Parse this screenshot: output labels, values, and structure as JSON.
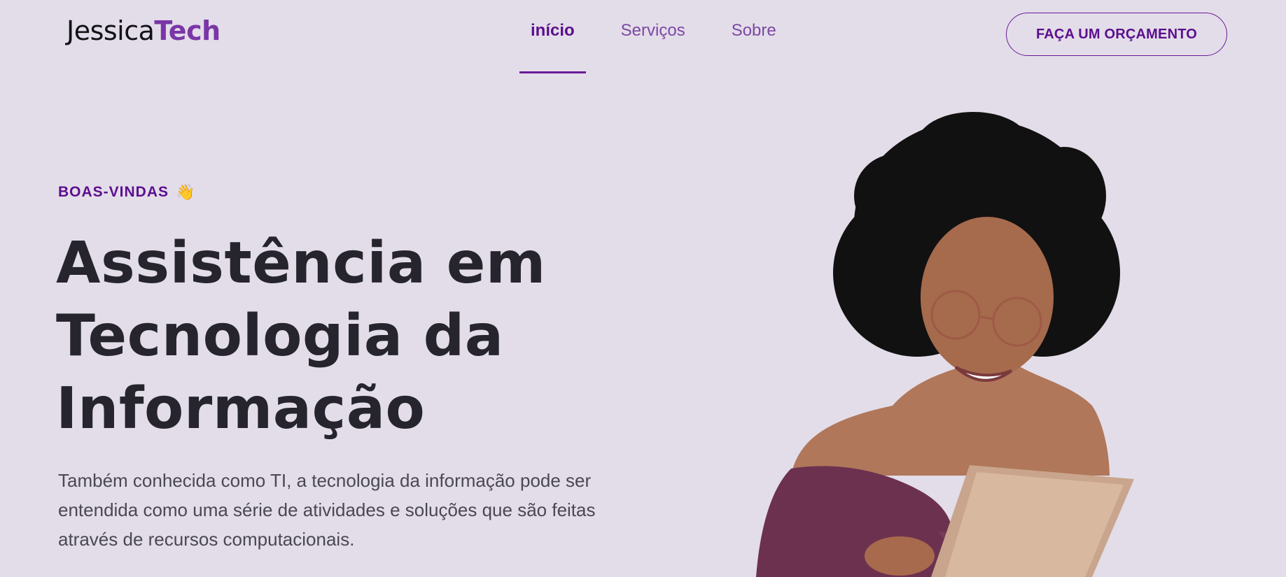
{
  "header": {
    "logo_main": "Jessica",
    "logo_accent": "Tech",
    "nav": [
      {
        "label": "início",
        "active": true
      },
      {
        "label": "Serviços",
        "active": false
      },
      {
        "label": "Sobre",
        "active": false
      }
    ],
    "cta_label": "FAÇA UM ORÇAMENTO"
  },
  "hero": {
    "eyebrow": "BOAS-VINDAS",
    "eyebrow_icon": "👋",
    "headline": [
      "Assistência em",
      "Tecnologia da",
      "Informação"
    ],
    "lead": [
      "Também conhecida como TI, a tecnologia da informação pode ser",
      "entendida como uma série de atividades e soluções que são feitas",
      "através de recursos computacionais."
    ]
  },
  "colors": {
    "background": "#e3dde9",
    "accent": "#7a36a6",
    "accent_dark": "#5b0f8d",
    "text": "#24232b"
  },
  "icons": {
    "eyebrow": "waving-hand-icon"
  }
}
